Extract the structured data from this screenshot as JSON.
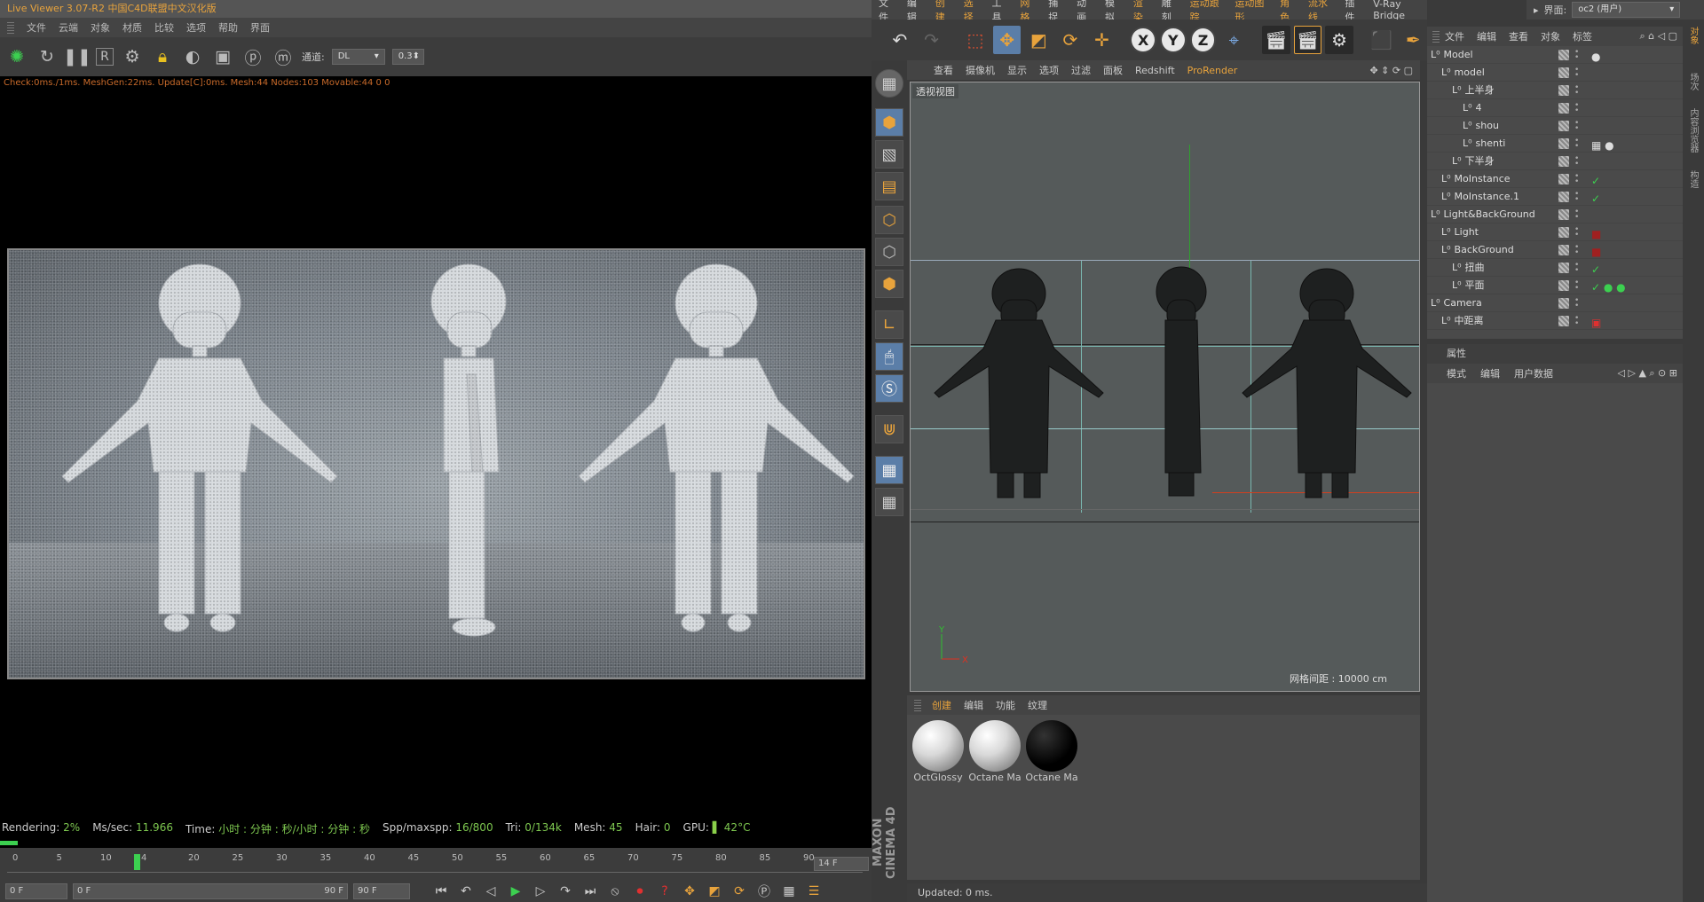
{
  "live_viewer": {
    "title": "Live Viewer 3.07-R2 中国C4D联盟中文汉化版",
    "menu": [
      "文件",
      "云端",
      "对象",
      "材质",
      "比较",
      "选项",
      "帮助",
      "界面"
    ],
    "channel_label": "通道:",
    "channel_value": "DL",
    "channel_param": "0.3",
    "stats_line": "Check:0ms./1ms. MeshGen:22ms. Update[C]:0ms. Mesh:44 Nodes:103 Movable:44  0 0",
    "bottom": {
      "rendering_label": "Rendering:",
      "rendering_value": "2%",
      "mssec_label": "Ms/sec:",
      "mssec_value": "11.966",
      "time_label": "Time:",
      "time_value": "小时 : 分钟 : 秒/小时 : 分钟 : 秒",
      "spp_label": "Spp/maxspp:",
      "spp_value": "16/800",
      "tri_label": "Tri:",
      "tri_value": "0/134k",
      "mesh_label": "Mesh:",
      "mesh_value": "45",
      "hair_label": "Hair:",
      "hair_value": "0",
      "gpu_label": "GPU:",
      "gpu_value": "42°C"
    },
    "render_progress": 0.02
  },
  "timeline": {
    "ticks": [
      "0",
      "5",
      "10",
      "14",
      "20",
      "25",
      "30",
      "35",
      "40",
      "45",
      "50",
      "55",
      "60",
      "65",
      "70",
      "75",
      "80",
      "85",
      "90"
    ],
    "current_frame": "14 F",
    "start": "0 F",
    "range_start": "0 F",
    "range_end": "90 F",
    "end": "90 F"
  },
  "c4d": {
    "menu": [
      "文件",
      "编辑",
      "创建",
      "选择",
      "工具",
      "网格",
      "捕捉",
      "动画",
      "模拟",
      "渲染",
      "雕刻",
      "运动跟踪",
      "运动图形",
      "角色",
      "流水线",
      "插件",
      "V-Ray Bridge"
    ],
    "layout_label": "界面:",
    "layout_value": "oc2 (用户)",
    "viewport_menu": [
      "查看",
      "摄像机",
      "显示",
      "选项",
      "过滤",
      "面板",
      "Redshift",
      "ProRender"
    ],
    "viewport_label": "透视视图",
    "grid_spacing": "网格间距 : 10000 cm",
    "material_menu": [
      "创建",
      "编辑",
      "功能",
      "纹理"
    ],
    "materials": [
      "OctGlossy",
      "Octane Ma",
      "Octane Ma"
    ],
    "status": "Updated: 0 ms.",
    "brand": "MAXON CINEMA 4D"
  },
  "object_manager": {
    "menu": [
      "文件",
      "编辑",
      "查看",
      "对象",
      "标签"
    ],
    "rows": [
      {
        "name": "Model",
        "indent": 0,
        "tag": "●"
      },
      {
        "name": "model",
        "indent": 1,
        "tag": ""
      },
      {
        "name": "上半身",
        "indent": 2,
        "tag": ""
      },
      {
        "name": "4",
        "indent": 3,
        "tag": ""
      },
      {
        "name": "shou",
        "indent": 3,
        "tag": ""
      },
      {
        "name": "shenti",
        "indent": 3,
        "tag": "▦ ●"
      },
      {
        "name": "下半身",
        "indent": 2,
        "tag": ""
      },
      {
        "name": "MoInstance",
        "indent": 1,
        "tag": "✓"
      },
      {
        "name": "MoInstance.1",
        "indent": 1,
        "tag": "✓"
      },
      {
        "name": "Light&BackGround",
        "indent": 0,
        "tag": ""
      },
      {
        "name": "Light",
        "indent": 1,
        "tag": "■"
      },
      {
        "name": "BackGround",
        "indent": 1,
        "tag": "■"
      },
      {
        "name": "扭曲",
        "indent": 2,
        "tag": "✓"
      },
      {
        "name": "平面",
        "indent": 2,
        "tag": "✓ ● ●"
      },
      {
        "name": "Camera",
        "indent": 0,
        "tag": ""
      },
      {
        "name": "中距离",
        "indent": 1,
        "tag": "▣"
      }
    ]
  },
  "attributes": {
    "title": "属性",
    "menu": [
      "模式",
      "编辑",
      "用户数据"
    ]
  },
  "right_tabs": [
    "对象",
    "场次",
    "内容浏览器",
    "构造"
  ]
}
